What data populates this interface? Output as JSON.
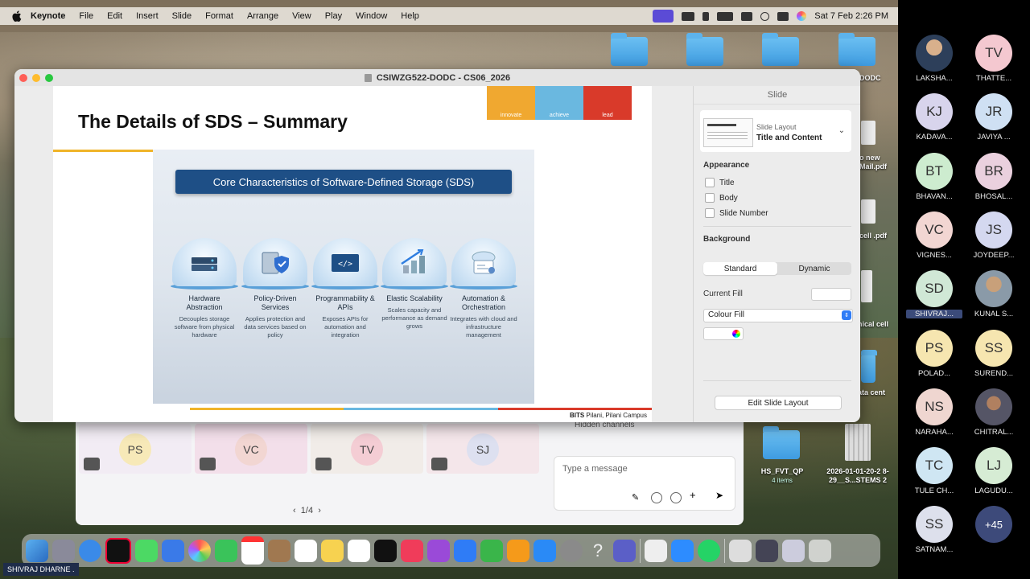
{
  "menubar": {
    "app": "Keynote",
    "items": [
      "File",
      "Edit",
      "Insert",
      "Slide",
      "Format",
      "Arrange",
      "View",
      "Play",
      "Window",
      "Help"
    ],
    "clock": "Sat 7 Feb  2:26 PM"
  },
  "desktop": {
    "labels": {
      "dodc": "DODC",
      "pdf1": "o new Mail.pdf",
      "pdf2": "cell .pdf",
      "nical": "nical cell",
      "datacent": "ata cent",
      "hs_name": "HS_FVT_QP",
      "hs_sub": "4 items",
      "file2": "2026-01-01-20-2 8-29__S...STEMS 2"
    }
  },
  "window": {
    "title": "CSIWZG522-DODC - CS06_2026"
  },
  "slide": {
    "title": "The Details of SDS – Summary",
    "brand": [
      "innovate",
      "achieve",
      "lead"
    ],
    "infographic_title": "Core Characteristics of Software-Defined Storage (SDS)",
    "cards": [
      {
        "title": "Hardware Abstraction",
        "desc": "Decouples storage software from physical hardware"
      },
      {
        "title": "Policy-Driven Services",
        "desc": "Applies protection and data services based on policy"
      },
      {
        "title": "Programmability & APIs",
        "desc": "Exposes APIs for automation and integration"
      },
      {
        "title": "Elastic Scalability",
        "desc": "Scales capacity and performance as demand grows"
      },
      {
        "title": "Automation & Orchestration",
        "desc": "Integrates with cloud and infrastructure management"
      }
    ],
    "footer_bold": "BITS",
    "footer_rest": " Pilani, Pilani Campus"
  },
  "inspector": {
    "header": "Slide",
    "layout_label": "Slide Layout",
    "layout_value": "Title and Content",
    "appearance": "Appearance",
    "options": [
      "Title",
      "Body",
      "Slide Number"
    ],
    "background": "Background",
    "seg": [
      "Standard",
      "Dynamic"
    ],
    "current_fill": "Current Fill",
    "fill_type": "Colour Fill",
    "edit_button": "Edit Slide Layout"
  },
  "meeting": {
    "hidden_channels": "Hidden channels",
    "tiles": [
      "PS",
      "VC",
      "TV",
      "SJ"
    ],
    "pager": "1/4",
    "message_placeholder": "Type a message"
  },
  "badge": "SHIVRAJ DHARNE .",
  "participants": [
    {
      "initials": "",
      "name": "LAKSHA...",
      "photo": "photo"
    },
    {
      "initials": "TV",
      "name": "THATTE...",
      "color": "#f4c8d0"
    },
    {
      "initials": "KJ",
      "name": "KADAVA...",
      "color": "#d8d4ec"
    },
    {
      "initials": "JR",
      "name": "JAVIYA ...",
      "color": "#cfe0f3"
    },
    {
      "initials": "BT",
      "name": "BHAVAN...",
      "color": "#cdeccf"
    },
    {
      "initials": "BR",
      "name": "BHOSAL...",
      "color": "#ead0de"
    },
    {
      "initials": "VC",
      "name": "VIGNES...",
      "color": "#f2d6d2"
    },
    {
      "initials": "JS",
      "name": "JOYDEEP...",
      "color": "#d4d8f0"
    },
    {
      "initials": "SD",
      "name": "SHIVRAJ...",
      "color": "#d0e8d6",
      "hl": true
    },
    {
      "initials": "",
      "name": "KUNAL S...",
      "photo": "photo2"
    },
    {
      "initials": "PS",
      "name": "POLAD...",
      "color": "#f6e6b0"
    },
    {
      "initials": "SS",
      "name": "SUREND...",
      "color": "#f6e6b0"
    },
    {
      "initials": "NS",
      "name": "NARAHA...",
      "color": "#efd6d0"
    },
    {
      "initials": "",
      "name": "CHITRAL...",
      "photo": "photo3"
    },
    {
      "initials": "TC",
      "name": "TULE CH...",
      "color": "#cfe6f3"
    },
    {
      "initials": "LJ",
      "name": "LAGUDU...",
      "color": "#d6ecd4"
    },
    {
      "initials": "SS",
      "name": "SATNAM...",
      "color": "#dde0ec"
    },
    {
      "initials": "+45",
      "name": "",
      "more": true
    }
  ]
}
